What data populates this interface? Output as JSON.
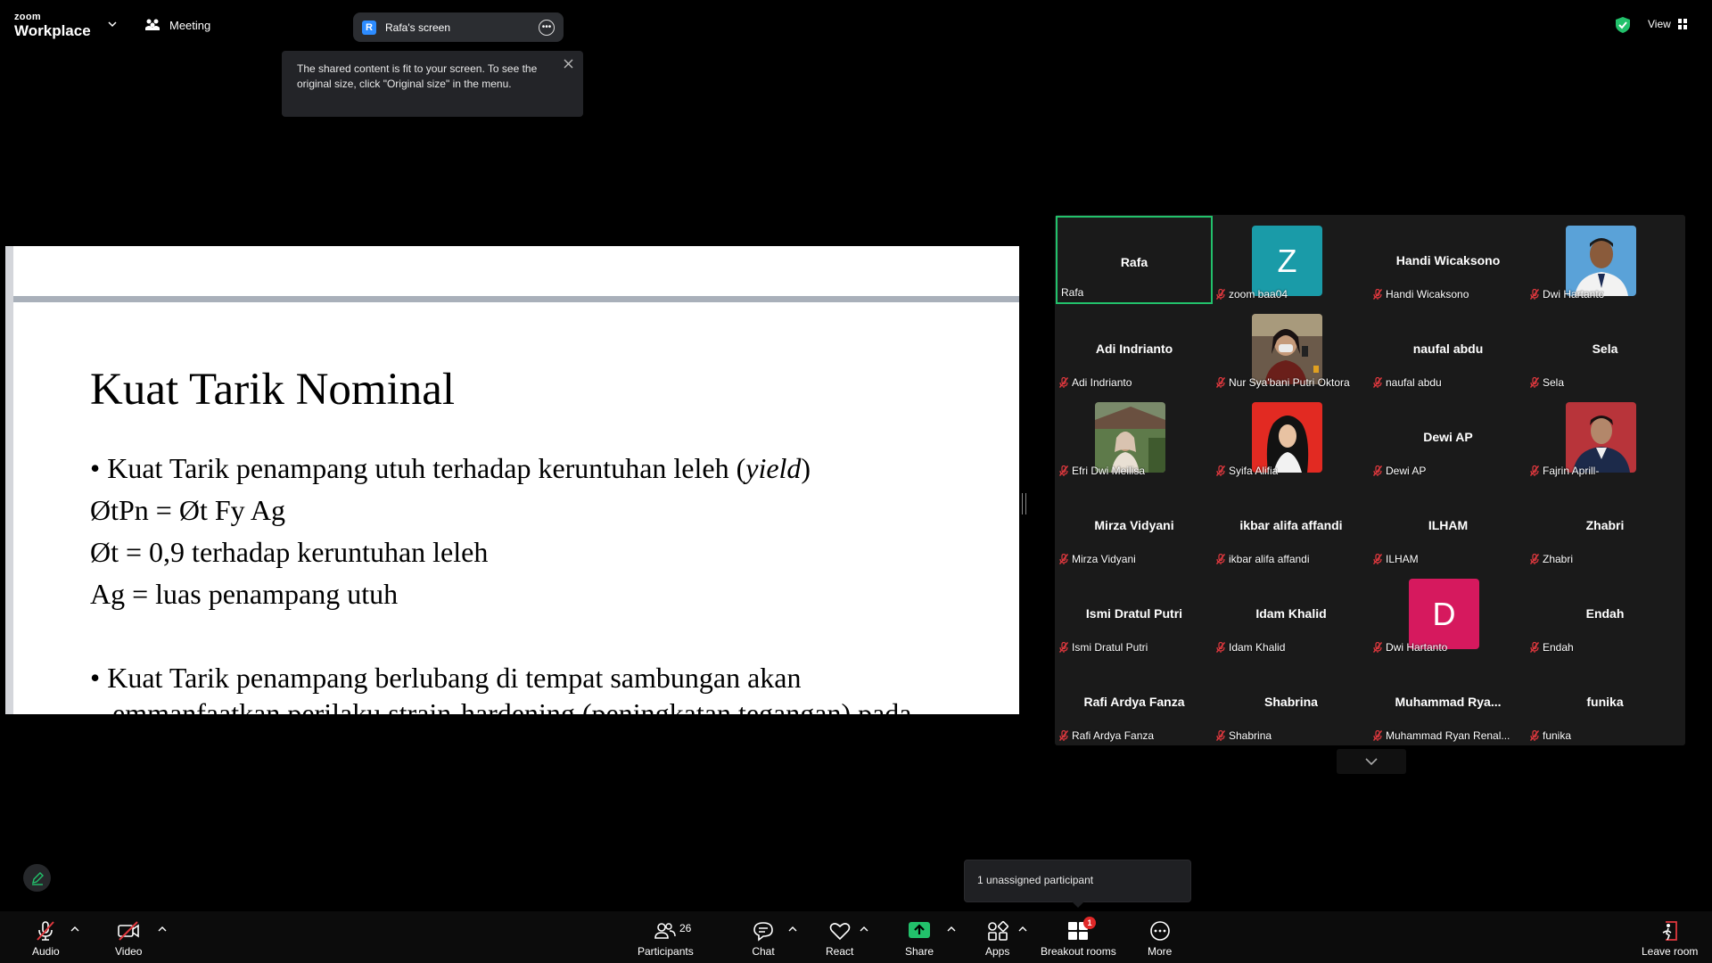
{
  "app": {
    "brand_small": "zoom",
    "brand_large": "Workplace"
  },
  "header": {
    "meeting_label": "Meeting",
    "screen_share": {
      "badge": "R",
      "label": "Rafa's screen"
    },
    "view_label": "View"
  },
  "tooltip": {
    "text": "The shared content is fit to your screen. To see the original size, click \"Original size\" in the menu."
  },
  "slide": {
    "title": "Kuat Tarik Nominal",
    "line1_a": "• Kuat Tarik penampang utuh terhadap keruntuhan leleh (",
    "line1_italic": "yield",
    "line1_b": ")",
    "line2": "ØtPn = Øt Fy Ag",
    "line3": "Øt = 0,9 terhadap keruntuhan leleh",
    "line4": "Ag = luas penampang utuh",
    "line5": "• Kuat Tarik penampang berlubang di tempat sambungan akan",
    "line6": "emmanfaatkan perilaku strain-hardening (peningkatan tegangan) pada"
  },
  "participants": [
    {
      "center": "Rafa",
      "label": "Rafa",
      "muted": false,
      "active": true
    },
    {
      "avatar": "Z",
      "avatar_color": "#1a9ba8",
      "label": "zoom baa04",
      "muted": true
    },
    {
      "center": "Handi Wicaksono",
      "label": "Handi Wicaksono",
      "muted": true
    },
    {
      "photo": "man-blue-bg",
      "label": "Dwi Hartanto",
      "muted": true
    },
    {
      "center": "Adi Indrianto",
      "label": "Adi Indrianto",
      "muted": true
    },
    {
      "photo": "woman-mask",
      "label": "Nur Sya'bani Putri Oktora",
      "muted": true
    },
    {
      "center": "naufal abdu",
      "label": "naufal abdu",
      "muted": true
    },
    {
      "center": "Sela",
      "label": "Sela",
      "muted": true
    },
    {
      "photo": "woman-outdoor",
      "label": "Efri Dwi Meilisa",
      "muted": true
    },
    {
      "photo": "woman-hijab-red",
      "label": "Syifa Alifia",
      "muted": true
    },
    {
      "center": "Dewi AP",
      "label": "Dewi AP",
      "muted": true
    },
    {
      "photo": "man-red-bg",
      "label": "Fajrin Aprill-",
      "muted": true
    },
    {
      "center": "Mirza Vidyani",
      "label": "Mirza Vidyani",
      "muted": true
    },
    {
      "center": "ikbar alifa affandi",
      "label": "ikbar alifa affandi",
      "muted": true
    },
    {
      "center": "ILHAM",
      "label": "ILHAM",
      "muted": true
    },
    {
      "center": "Zhabri",
      "label": "Zhabri",
      "muted": true
    },
    {
      "center": "Ismi Dratul Putri",
      "label": "Ismi Dratul Putri",
      "muted": true
    },
    {
      "center": "Idam Khalid",
      "label": "Idam Khalid",
      "muted": true
    },
    {
      "avatar": "D",
      "avatar_color": "#d6195e",
      "label": "Dwi Hartanto",
      "muted": true
    },
    {
      "center": "Endah",
      "label": "Endah",
      "muted": true
    },
    {
      "center": "Rafi Ardya Fanza",
      "label": "Rafi Ardya Fanza",
      "muted": true
    },
    {
      "center": "Shabrina",
      "label": "Shabrina",
      "muted": true
    },
    {
      "center": "Muhammad  Rya...",
      "label": "Muhammad Ryan Renal...",
      "muted": true
    },
    {
      "center": "funika",
      "label": "funika",
      "muted": true
    }
  ],
  "unassigned": {
    "text": "1 unassigned participant"
  },
  "toolbar": {
    "audio": "Audio",
    "video": "Video",
    "participants": "Participants",
    "participants_count": "26",
    "chat": "Chat",
    "react": "React",
    "share": "Share",
    "apps": "Apps",
    "breakout": "Breakout rooms",
    "breakout_badge": "1",
    "more": "More",
    "leave": "Leave room"
  },
  "colors": {
    "active_border": "#22c16b",
    "share_green": "#22c16b",
    "muted_red": "#e0383e",
    "shield_green": "#22c16b"
  }
}
